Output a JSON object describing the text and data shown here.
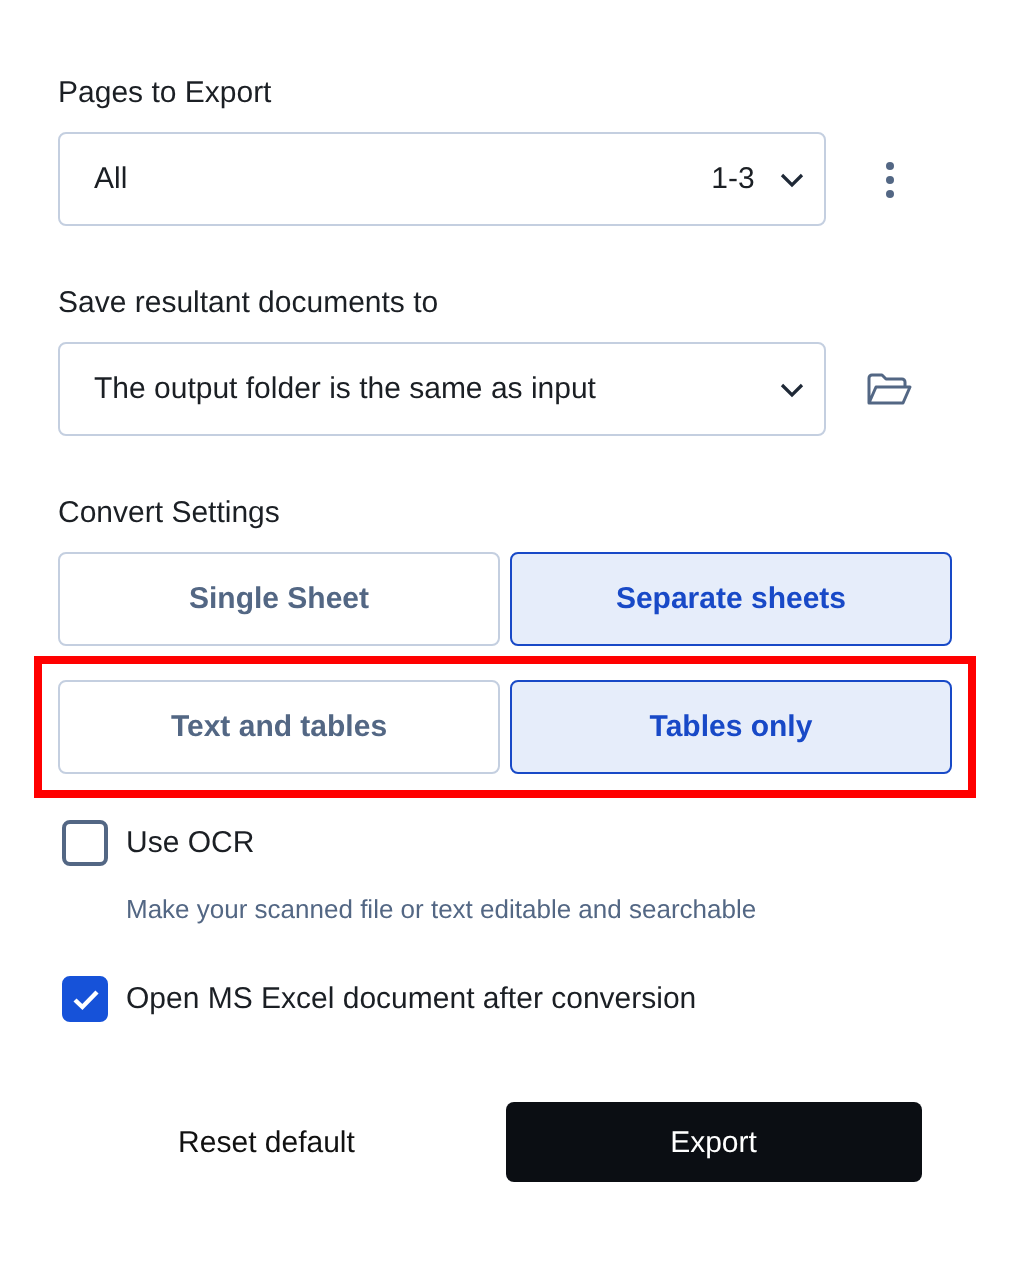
{
  "pages_to_export": {
    "label": "Pages to Export",
    "value": "All",
    "range": "1-3"
  },
  "save_to": {
    "label": "Save resultant documents to",
    "value": "The output folder is the same as input"
  },
  "convert_settings": {
    "label": "Convert Settings",
    "groups": [
      {
        "highlighted": false,
        "options": [
          {
            "label": "Single Sheet",
            "selected": false
          },
          {
            "label": "Separate sheets",
            "selected": true
          }
        ]
      },
      {
        "highlighted": true,
        "options": [
          {
            "label": "Text and tables",
            "selected": false
          },
          {
            "label": "Tables only",
            "selected": true
          }
        ]
      }
    ]
  },
  "options": [
    {
      "label": "Use OCR",
      "checked": false,
      "hint": "Make your scanned file or text editable and searchable"
    },
    {
      "label": "Open MS Excel document after conversion",
      "checked": true
    }
  ],
  "buttons": [
    {
      "label": "Reset default",
      "kind": "plain"
    },
    {
      "label": "Export",
      "kind": "primary"
    }
  ]
}
